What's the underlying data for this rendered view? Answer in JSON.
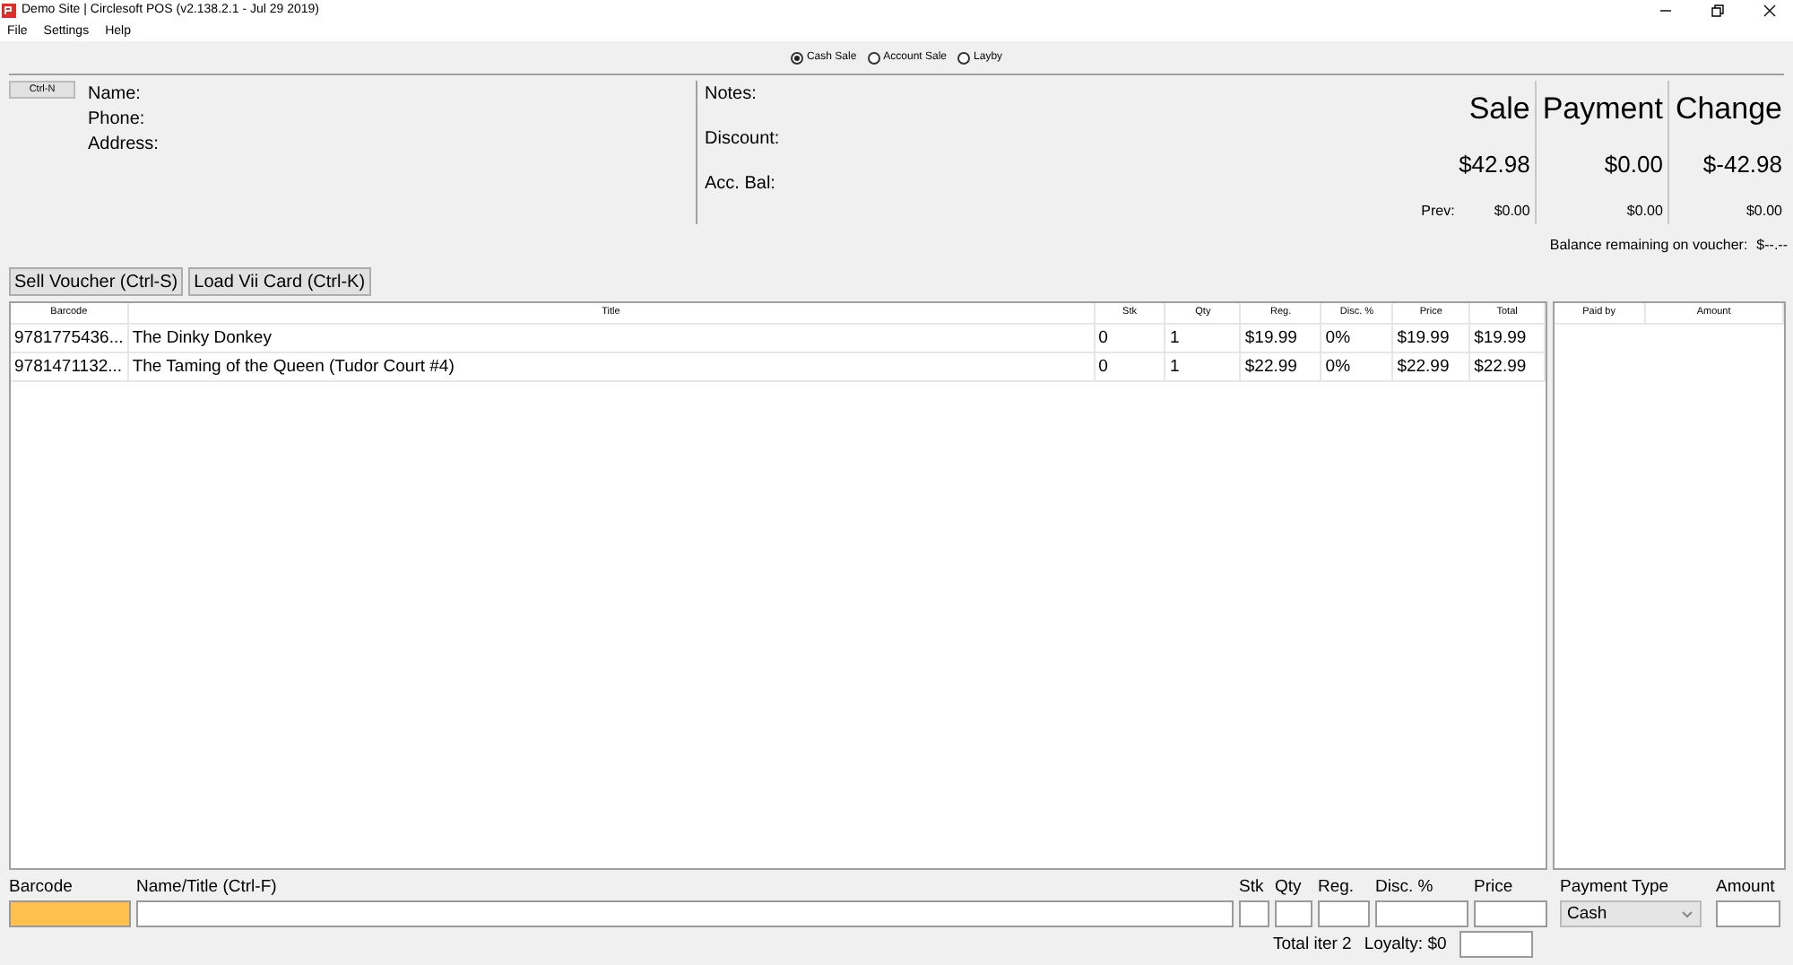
{
  "window": {
    "title": "Demo Site | Circlesoft POS (v2.138.2.1 - Jul 29 2019)"
  },
  "menu": [
    "File",
    "Settings",
    "Help"
  ],
  "sale_types": [
    {
      "label": "Cash Sale",
      "selected": true
    },
    {
      "label": "Account Sale",
      "selected": false
    },
    {
      "label": "Layby",
      "selected": false
    }
  ],
  "customer": {
    "new_button": "Ctrl-N",
    "labels": [
      "Name:",
      "Phone:",
      "Address:"
    ]
  },
  "notes_labels": [
    "Notes:",
    "Discount:",
    "Acc. Bal:"
  ],
  "totals": {
    "prev_label": "Prev:",
    "columns": [
      {
        "heading": "Sale",
        "amount": "$42.98",
        "prev": "$0.00"
      },
      {
        "heading": "Payment",
        "amount": "$0.00",
        "prev": "$0.00"
      },
      {
        "heading": "Change",
        "amount": "$-42.98",
        "prev": "$0.00"
      }
    ]
  },
  "voucher_balance": {
    "label": "Balance remaining on voucher:",
    "value": "$--.--"
  },
  "action_buttons": [
    "Sell Voucher (Ctrl-S)",
    "Load Vii Card (Ctrl-K)"
  ],
  "items_table": {
    "columns": [
      "Barcode",
      "Title",
      "Stk",
      "Qty",
      "Reg.",
      "Disc. %",
      "Price",
      "Total"
    ],
    "rows": [
      [
        "9781775436...",
        "The Dinky Donkey",
        "0",
        "1",
        "$19.99",
        "0%",
        "$19.99",
        "$19.99"
      ],
      [
        "9781471132...",
        "The Taming of the Queen (Tudor Court #4)",
        "0",
        "1",
        "$22.99",
        "0%",
        "$22.99",
        "$22.99"
      ]
    ]
  },
  "payments_table": {
    "columns": [
      "Paid by",
      "Amount"
    ]
  },
  "entry": {
    "labels": [
      "Barcode",
      "Name/Title (Ctrl-F)",
      "Stk",
      "Qty",
      "Reg.",
      "Disc. %",
      "Price",
      "Payment Type",
      "Amount"
    ],
    "barcode_focused": true,
    "payment_type": "Cash"
  },
  "summary": {
    "total_items": "Total iter 2",
    "loyalty": "Loyalty: $0"
  }
}
